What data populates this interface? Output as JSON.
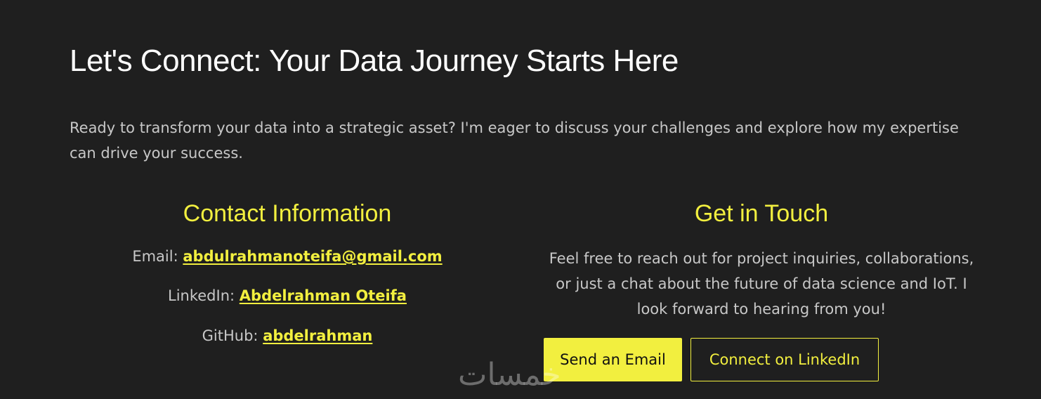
{
  "header": {
    "title": "Let's Connect: Your Data Journey Starts Here"
  },
  "intro": {
    "text": "Ready to transform your data into a strategic asset? I'm eager to discuss your challenges and explore how my expertise can drive your success."
  },
  "contact": {
    "heading": "Contact Information",
    "email_label": "Email:",
    "email_value": "abdulrahmanoteifa@gmail.com",
    "linkedin_label": "LinkedIn:",
    "linkedin_value": "Abdelrahman Oteifa",
    "github_label": "GitHub:",
    "github_value": "abdelrahman"
  },
  "touch": {
    "heading": "Get in Touch",
    "text": "Feel free to reach out for project inquiries, collaborations, or just a chat about the future of data science and IoT. I look forward to hearing from you!",
    "email_button": "Send an Email",
    "linkedin_button": "Connect on LinkedIn"
  },
  "watermark": {
    "text": "خمسات"
  },
  "colors": {
    "background": "#1f1f1f",
    "accent": "#f2ef3f",
    "title": "#ffffff",
    "body_text": "#c8c8c8"
  }
}
